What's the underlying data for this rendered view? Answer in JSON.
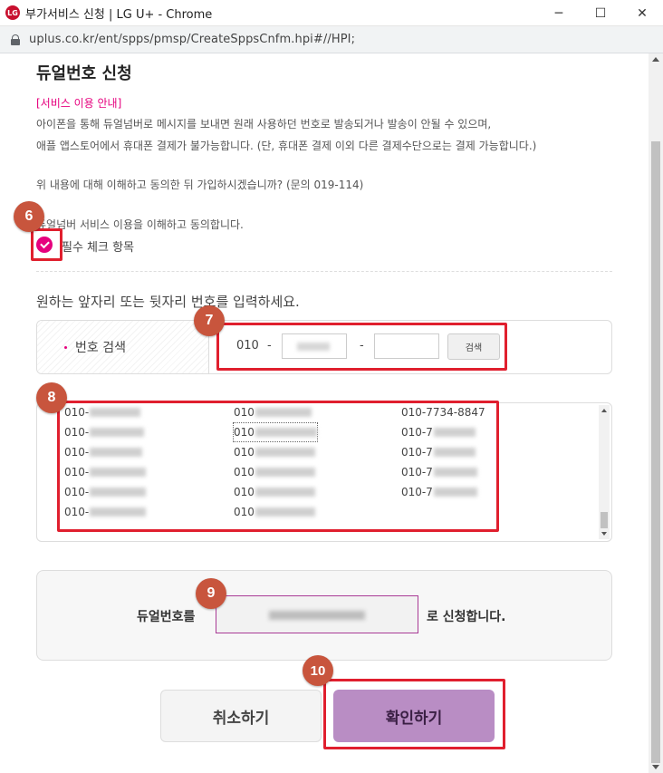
{
  "window": {
    "title": "부가서비스 신청 | LG U+ - Chrome",
    "logo_text": "LG",
    "minimize": "─",
    "maximize": "☐",
    "close": "✕"
  },
  "address_bar": {
    "url": "uplus.co.kr/ent/spps/pmsp/CreateSppsCnfm.hpi#//HPI;"
  },
  "page": {
    "title": "듀얼번호 신청",
    "notice_label": "[서비스 이용 안내]",
    "notice_lines": [
      "아이폰을 통해 듀얼넘버로 메시지를 보내면 원래 사용하던 번호로 발송되거나 발송이 안될 수 있으며,",
      "애플 앱스토어에서 휴대폰 결제가 불가능합니다. (단, 휴대폰 결제 이외 다른 결제수단으로는 결제 가능합니다.)"
    ],
    "question": "위 내용에 대해 이해하고 동의한 뒤 가입하시겠습니까? (문의 019-114)",
    "agree_text": "듀얼넘버 서비스 이용을 이해하고 동의합니다.",
    "agree_checked": true,
    "required_label": "필수 체크 항목",
    "input_guide": "원하는 앞자리 또는 뒷자리 번호를 입력하세요.",
    "search": {
      "label": "번호 검색",
      "prefix": "010",
      "dash": "-",
      "last_value": "",
      "button": "검색"
    },
    "results": {
      "col1": [
        "010-",
        "010-",
        "010-",
        "010-",
        "010-",
        "010-"
      ],
      "col2": [
        "010",
        "010",
        "010",
        "010",
        "010",
        "010"
      ],
      "col3": [
        "010-7734-8847",
        "010-7",
        "010-7",
        "010-7",
        "010-7"
      ]
    },
    "apply": {
      "pre": "듀얼번호를",
      "post": "로 신청합니다."
    },
    "buttons": {
      "cancel": "취소하기",
      "confirm": "확인하기"
    }
  },
  "annotations": [
    "6",
    "7",
    "8",
    "9",
    "10"
  ],
  "colors": {
    "accent": "#e6007e",
    "confirm": "#b98dc4",
    "highlight": "#e01f2e",
    "badge": "#c8553d"
  }
}
